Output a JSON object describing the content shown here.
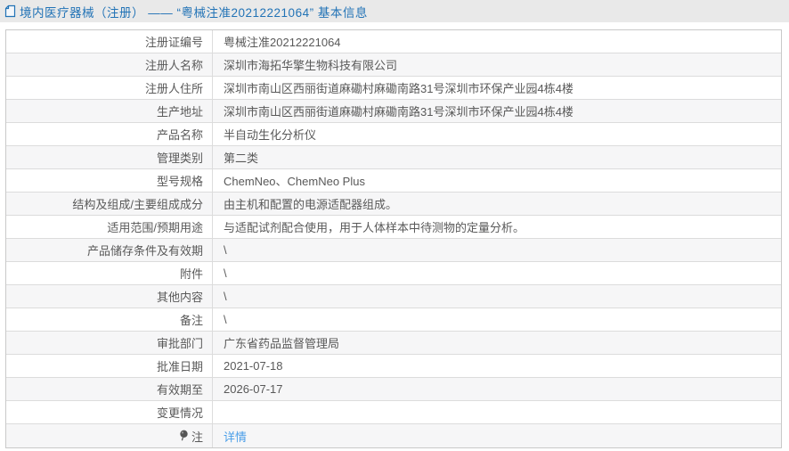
{
  "header": {
    "icon": "document-icon",
    "title": "境内医疗器械（注册） —— “粤械注准20212221064” 基本信息"
  },
  "table": {
    "rows": [
      {
        "label": "注册证编号",
        "value": "粤械注准20212221064"
      },
      {
        "label": "注册人名称",
        "value": "深圳市海拓华擎生物科技有限公司"
      },
      {
        "label": "注册人住所",
        "value": "深圳市南山区西丽街道麻磡村麻磡南路31号深圳市环保产业园4栋4楼"
      },
      {
        "label": "生产地址",
        "value": "深圳市南山区西丽街道麻磡村麻磡南路31号深圳市环保产业园4栋4楼"
      },
      {
        "label": "产品名称",
        "value": "半自动生化分析仪"
      },
      {
        "label": "管理类别",
        "value": "第二类"
      },
      {
        "label": "型号规格",
        "value": "ChemNeo、ChemNeo Plus"
      },
      {
        "label": "结构及组成/主要组成成分",
        "value": "由主机和配置的电源适配器组成。"
      },
      {
        "label": "适用范围/预期用途",
        "value": "与适配试剂配合使用，用于人体样本中待测物的定量分析。"
      },
      {
        "label": "产品储存条件及有效期",
        "value": "\\"
      },
      {
        "label": "附件",
        "value": "\\"
      },
      {
        "label": "其他内容",
        "value": "\\"
      },
      {
        "label": "备注",
        "value": "\\"
      },
      {
        "label": "审批部门",
        "value": "广东省药品监督管理局"
      },
      {
        "label": "批准日期",
        "value": "2021-07-18"
      },
      {
        "label": "有效期至",
        "value": "2026-07-17"
      },
      {
        "label": "变更情况",
        "value": ""
      },
      {
        "label": "注",
        "value": "详情",
        "value_is_link": true,
        "label_icon": "note-balloon-icon"
      }
    ]
  },
  "colors": {
    "accent": "#2273b6",
    "link": "#4a9ee8",
    "header_bg": "#e9e9e9",
    "row_alt": "#f6f6f7",
    "border_outer": "#c9c9c9",
    "border_inner": "#dcdcdc",
    "text": "#595959"
  }
}
